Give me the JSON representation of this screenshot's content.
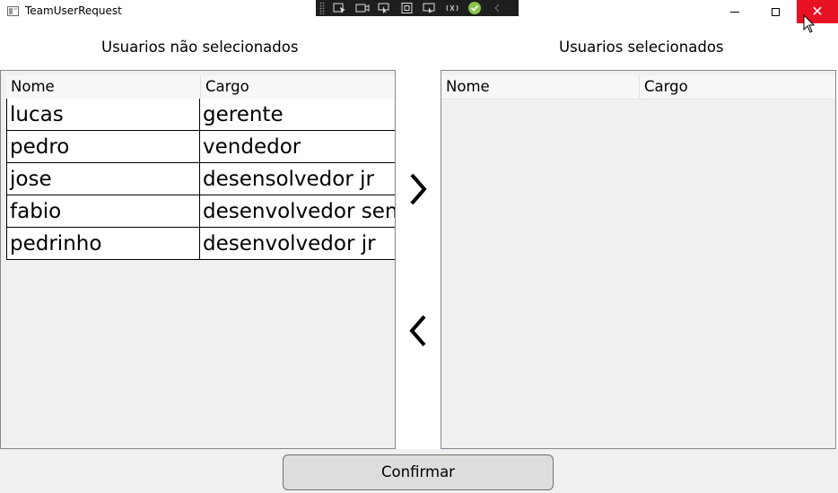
{
  "window": {
    "title": "TeamUserRequest",
    "close_glyph": "✕"
  },
  "colors": {
    "close_hover": "#e81123",
    "grid_background": "#f0f0f0",
    "button_background": "#dddddd"
  },
  "debug_toolbar": {
    "icons": [
      "select-element-icon",
      "record-icon",
      "pointer-icon",
      "frame-icon",
      "track-focus-icon",
      "hot-reload-icon",
      "check-icon",
      "collapse-icon"
    ]
  },
  "left_panel": {
    "heading": "Usuarios não selecionados",
    "columns": {
      "nome": "Nome",
      "cargo": "Cargo"
    },
    "rows": [
      {
        "nome": "lucas",
        "cargo": "gerente"
      },
      {
        "nome": "pedro",
        "cargo": "vendedor"
      },
      {
        "nome": "jose",
        "cargo": "desensolvedor jr"
      },
      {
        "nome": "fabio",
        "cargo": "desenvolvedor senior"
      },
      {
        "nome": "pedrinho",
        "cargo": "desenvolvedor jr"
      }
    ]
  },
  "right_panel": {
    "heading": "Usuarios selecionados",
    "columns": {
      "nome": "Nome",
      "cargo": "Cargo"
    },
    "rows": []
  },
  "buttons": {
    "move_right_icon": "chevron-right-icon",
    "move_left_icon": "chevron-left-icon",
    "confirm_label": "Confirmar"
  }
}
